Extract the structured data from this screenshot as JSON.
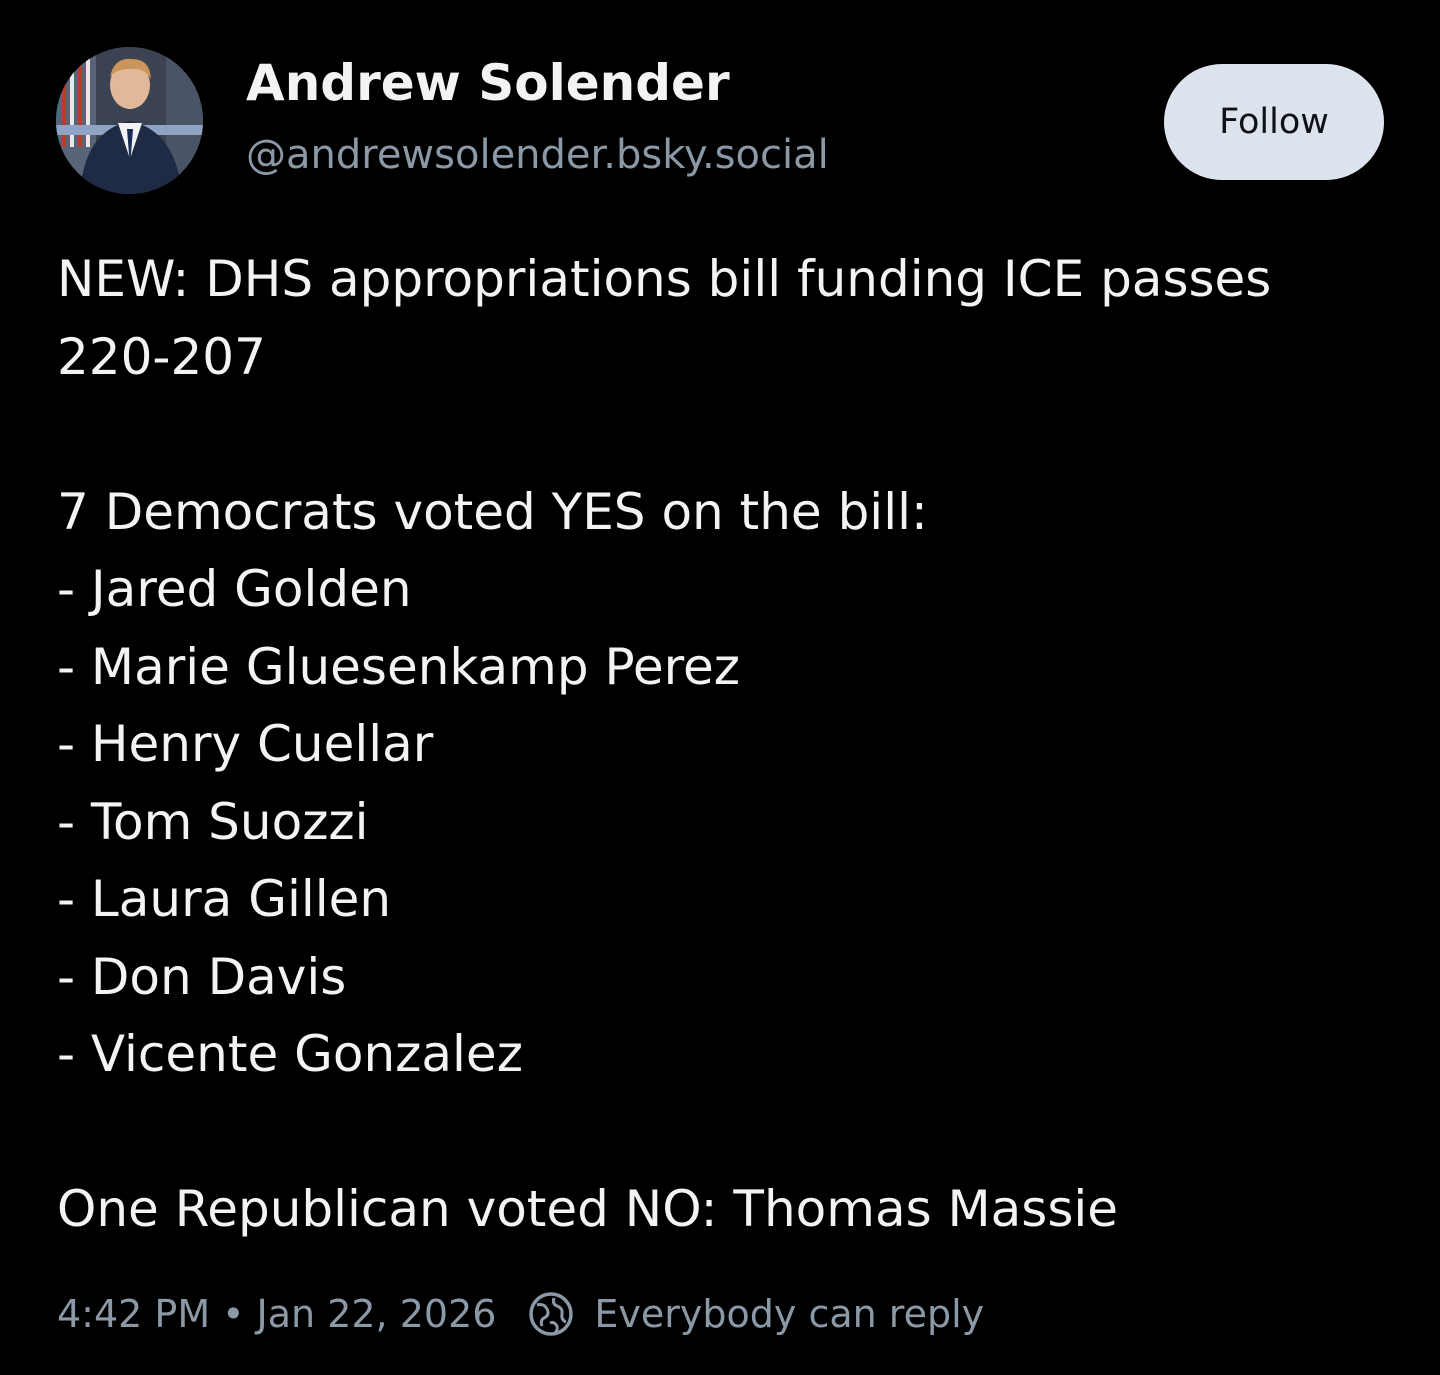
{
  "author": {
    "display_name": "Andrew Solender",
    "handle": "@andrewsolender.bsky.social"
  },
  "follow_button": {
    "label": "Follow"
  },
  "post": {
    "headline": "NEW: DHS appropriations bill funding ICE passes",
    "headline_cont": "220-207",
    "intro": "7 Democrats voted YES on the bill:",
    "names": [
      "- Jared Golden",
      "- Marie Gluesenkamp Perez",
      "- Henry Cuellar",
      "- Tom Suozzi",
      "- Laura Gillen",
      "- Don Davis",
      "- Vicente Gonzalez"
    ],
    "closing": "One Republican voted NO: Thomas Massie"
  },
  "meta": {
    "time": "4:42 PM",
    "separator": "•",
    "date": "Jan 22, 2026",
    "reply_setting": "Everybody can reply",
    "reply_icon": "globe-icon"
  },
  "colors": {
    "background": "#000000",
    "text": "#f1f3f5",
    "muted": "#8b98a5",
    "button_bg": "#dde3ec"
  }
}
